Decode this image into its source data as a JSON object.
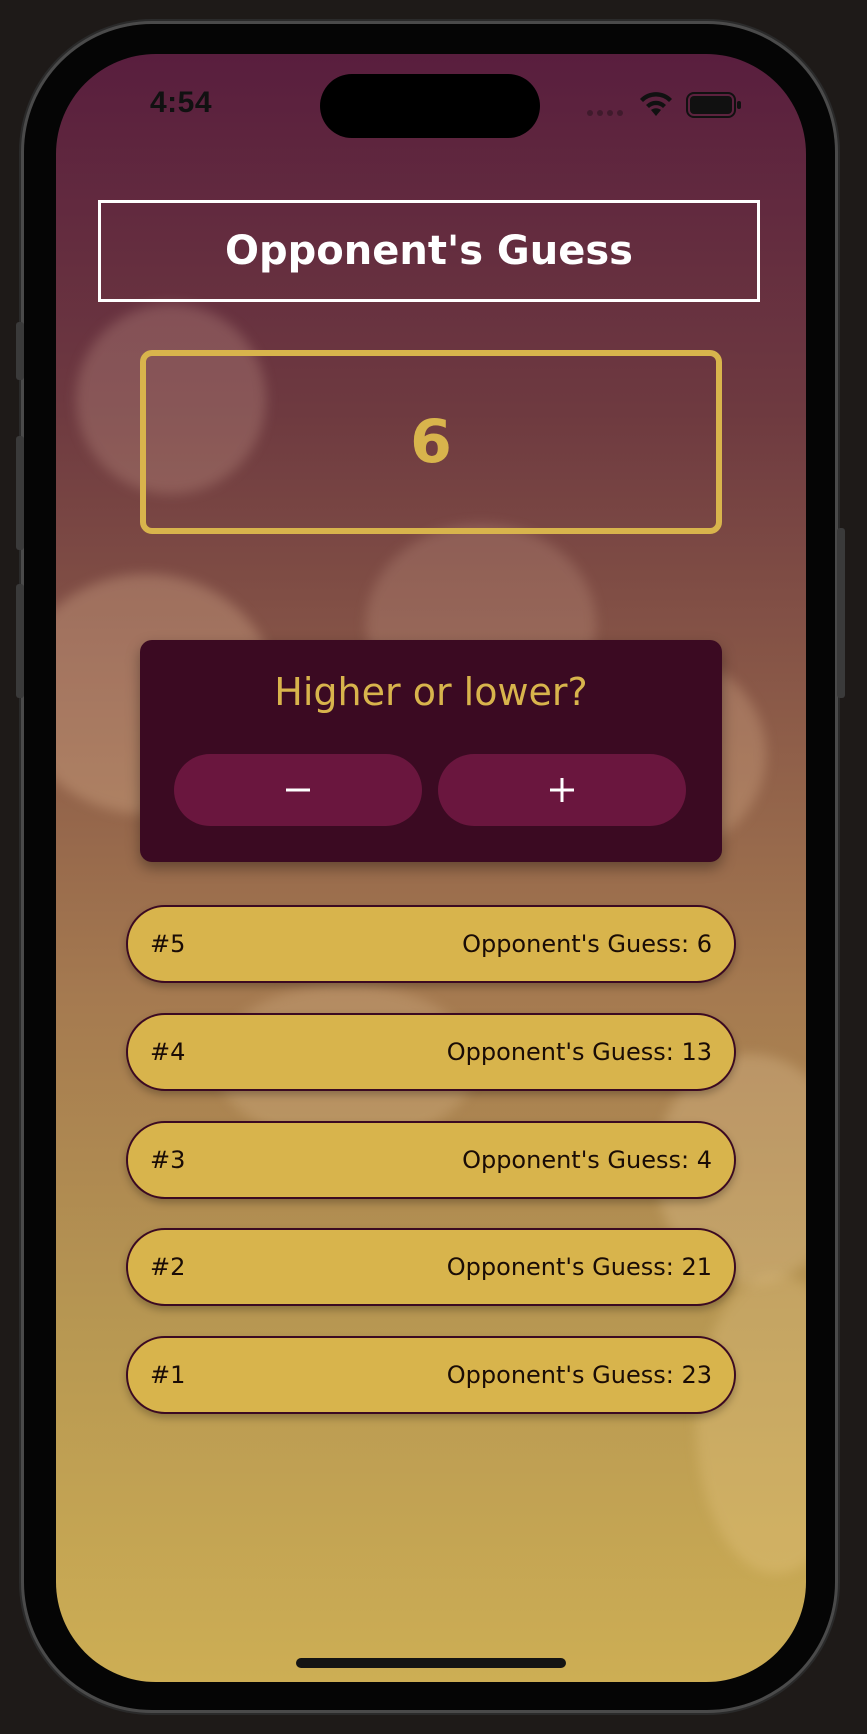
{
  "status_bar": {
    "time": "4:54"
  },
  "header": {
    "title": "Opponent's Guess"
  },
  "current_guess": {
    "value": "6"
  },
  "controls": {
    "prompt": "Higher or lower?",
    "minus_label": "−",
    "plus_label": "+"
  },
  "guess_log": [
    {
      "round": "#5",
      "text": "Opponent's Guess: 6"
    },
    {
      "round": "#4",
      "text": "Opponent's Guess: 13"
    },
    {
      "round": "#3",
      "text": "Opponent's Guess: 4"
    },
    {
      "round": "#2",
      "text": "Opponent's Guess: 21"
    },
    {
      "round": "#1",
      "text": "Opponent's Guess: 23"
    }
  ],
  "colors": {
    "accent_gold": "#d8b44c",
    "card_dark": "#3b0a22",
    "button_primary": "#6a163e",
    "title_white": "#ffffff"
  },
  "icons": {
    "wifi": "wifi-icon",
    "battery": "battery-icon"
  }
}
